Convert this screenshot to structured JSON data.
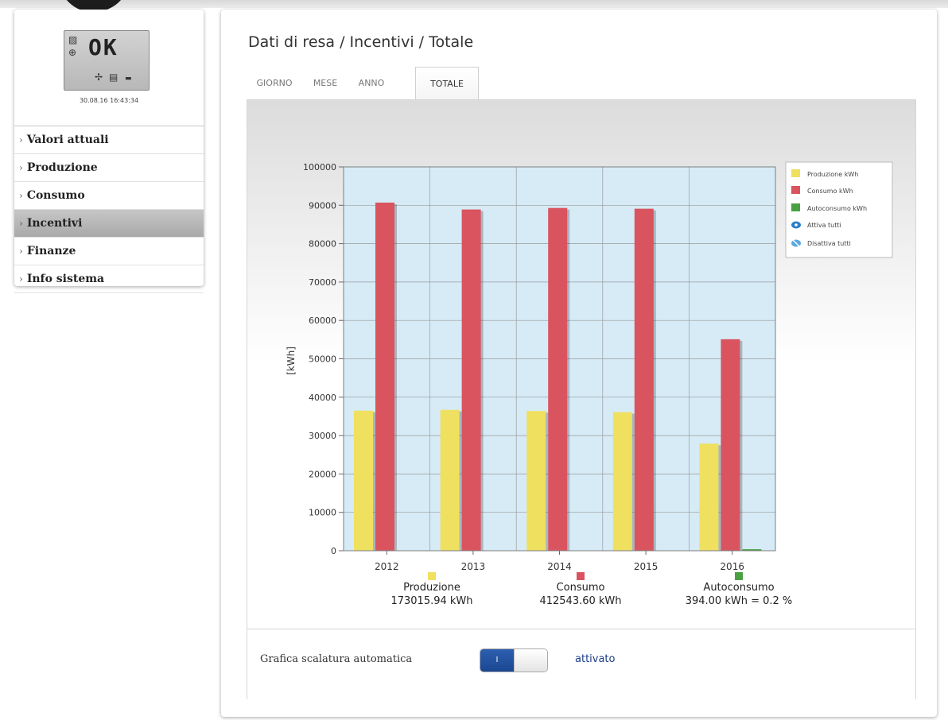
{
  "sidebar": {
    "lcd_status": "OK",
    "datetime": "30.08.16 16:43:34",
    "items": [
      {
        "label": "Valori attuali"
      },
      {
        "label": "Produzione"
      },
      {
        "label": "Consumo"
      },
      {
        "label": "Incentivi",
        "active": true
      },
      {
        "label": "Finanze"
      },
      {
        "label": "Info sistema"
      }
    ]
  },
  "main": {
    "title": "Dati di resa / Incentivi / Totale",
    "tabs": [
      {
        "label": "GIORNO"
      },
      {
        "label": "MESE"
      },
      {
        "label": "ANNO"
      },
      {
        "label": "TOTALE",
        "active": true
      }
    ]
  },
  "legend": {
    "items": [
      {
        "label": "Produzione kWh",
        "color": "#f0e060"
      },
      {
        "label": "Consumo kWh",
        "color": "#d9545e"
      },
      {
        "label": "Autoconsumo kWh",
        "color": "#4aa043"
      }
    ],
    "activate_all": "Attiva tutti",
    "deactivate_all": "Disattiva tutti"
  },
  "totals": [
    {
      "label": "Produzione",
      "value": "173015.94 kWh",
      "color": "#f0e060"
    },
    {
      "label": "Consumo",
      "value": "412543.60 kWh",
      "color": "#d9545e"
    },
    {
      "label": "Autoconsumo",
      "value": "394.00 kWh = 0.2 %",
      "color": "#4aa043"
    }
  ],
  "footer": {
    "label": "Grafica scalatura automatica",
    "toggle_on_text": "I",
    "toggle_status": "attivato"
  },
  "chart_data": {
    "type": "bar",
    "categories": [
      "2012",
      "2013",
      "2014",
      "2015",
      "2016"
    ],
    "series": [
      {
        "name": "Produzione kWh",
        "color": "#f0e060",
        "values": [
          36500,
          36700,
          36400,
          36100,
          27900
        ]
      },
      {
        "name": "Consumo kWh",
        "color": "#d9545e",
        "values": [
          90700,
          88900,
          89300,
          89100,
          55100
        ]
      },
      {
        "name": "Autoconsumo kWh",
        "color": "#4aa043",
        "values": [
          0,
          0,
          0,
          0,
          394
        ]
      }
    ],
    "ylabel": "[kWh]",
    "xlabel": "",
    "ylim": [
      0,
      100000
    ],
    "yticks": [
      0,
      10000,
      20000,
      30000,
      40000,
      50000,
      60000,
      70000,
      80000,
      90000,
      100000
    ],
    "grid": true,
    "legend_position": "right",
    "plot_background": "#d6ebf6"
  }
}
